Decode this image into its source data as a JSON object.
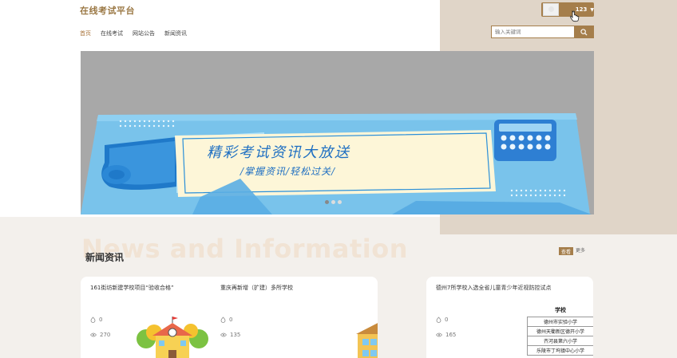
{
  "header": {
    "site_title": "在线考试平台",
    "nav": [
      "首页",
      "在线考试",
      "网站公告",
      "新闻资讯"
    ],
    "user_name": "123",
    "search_placeholder": "输入关键词"
  },
  "banner": {
    "title": "精彩考试资讯大放送",
    "subtitle": "/掌握资讯/轻松过关/",
    "slide_count": 3,
    "active_slide": 0
  },
  "news": {
    "bg_title": "News and Information",
    "title": "新闻资讯",
    "view_label": "查看",
    "more_label": "更多",
    "cards": [
      {
        "title": "161街坊新建学校项目“验收合格”",
        "likes": "0",
        "views": "270"
      },
      {
        "title": "重庆再新增（扩建）多所学校",
        "likes": "0",
        "views": "135"
      },
      {
        "title": "德州7所学校入选全省儿童青少年近视防控试点",
        "likes": "0",
        "views": "165"
      }
    ],
    "school_table": {
      "header": "学校",
      "rows": [
        "德州市实验小学",
        "德州天衢新区德开小学",
        "齐河县第六小学",
        "乐陵市丁坞镇中心小学"
      ]
    }
  },
  "colors": {
    "accent": "#a57e4b",
    "tan_bg": "#e0d5c8",
    "banner_blue": "#7ec8ee"
  }
}
